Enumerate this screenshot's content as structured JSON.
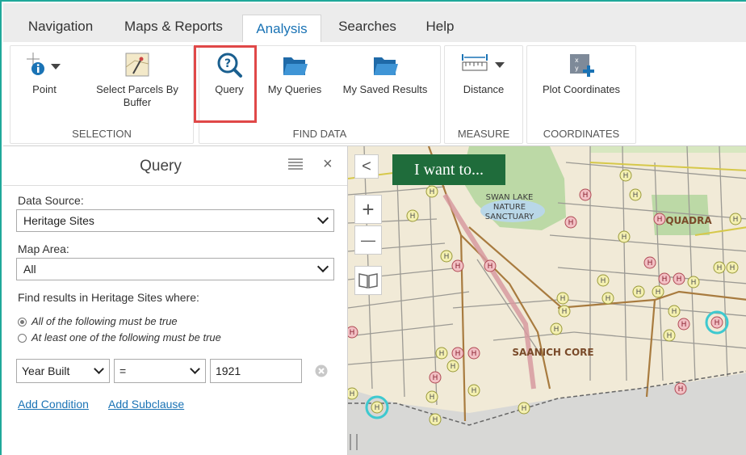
{
  "tabs": [
    {
      "label": "Navigation",
      "active": false
    },
    {
      "label": "Maps & Reports",
      "active": false
    },
    {
      "label": "Analysis",
      "active": true
    },
    {
      "label": "Searches",
      "active": false
    },
    {
      "label": "Help",
      "active": false
    }
  ],
  "ribbon": {
    "selection": {
      "group_label": "SELECTION",
      "point_label": "Point",
      "buffer_label_1": "Select Parcels By",
      "buffer_label_2": "Buffer"
    },
    "find_data": {
      "group_label": "FIND DATA",
      "query_label": "Query",
      "my_queries_label": "My Queries",
      "my_saved_results_label": "My Saved Results"
    },
    "measure": {
      "group_label": "MEASURE",
      "distance_label": "Distance"
    },
    "coordinates": {
      "group_label": "COORDINATES",
      "plot_label": "Plot Coordinates"
    }
  },
  "query_panel": {
    "title": "Query",
    "close_glyph": "×",
    "data_source_label": "Data Source:",
    "data_source_value": "Heritage Sites",
    "map_area_label": "Map Area:",
    "map_area_value": "All",
    "find_results_label": "Find results in Heritage Sites where:",
    "radio_all": "All of the following must be true",
    "radio_any": "At least one of the following must be true",
    "condition": {
      "field": "Year Built",
      "operator": "=",
      "value": "1921"
    },
    "add_condition": "Add Condition",
    "add_subclause": "Add Subclause"
  },
  "map": {
    "i_want_to": "I want to...",
    "collapse_glyph": "<",
    "zoom_in_glyph": "+",
    "zoom_out_glyph": "—",
    "labels": {
      "swan_lake_1": "SWAN LAKE",
      "swan_lake_2": "NATURE",
      "swan_lake_3": "SANCTUARY",
      "quadra": "QUADRA",
      "saanich_core": "SAANICH CORE"
    },
    "heritage_marker_glyph": "H"
  },
  "colors": {
    "accent": "#1a73b5",
    "highlight": "#e04848",
    "iwant_bg": "#1f6c3b",
    "frame": "#1fa89a"
  }
}
